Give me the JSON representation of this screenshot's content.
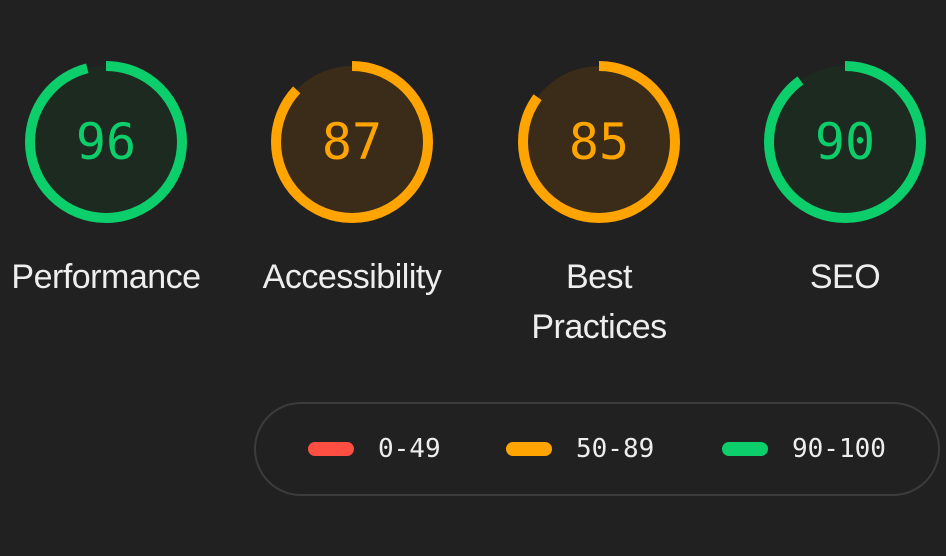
{
  "scores": [
    {
      "label": "Performance",
      "score": "96",
      "value": 96,
      "color": "#0cce6b",
      "fill": "#1c2a20"
    },
    {
      "label": "Accessibility",
      "score": "87",
      "value": 87,
      "color": "#ffa400",
      "fill": "#3a2c18"
    },
    {
      "label": "Best Practices",
      "score": "85",
      "value": 85,
      "color": "#ffa400",
      "fill": "#3a2c18"
    },
    {
      "label": "SEO",
      "score": "90",
      "value": 90,
      "color": "#0cce6b",
      "fill": "#1c2a20"
    }
  ],
  "legend": [
    {
      "range": "0-49",
      "color": "#ff4e42"
    },
    {
      "range": "50-89",
      "color": "#ffa400"
    },
    {
      "range": "90-100",
      "color": "#0cce6b"
    }
  ]
}
